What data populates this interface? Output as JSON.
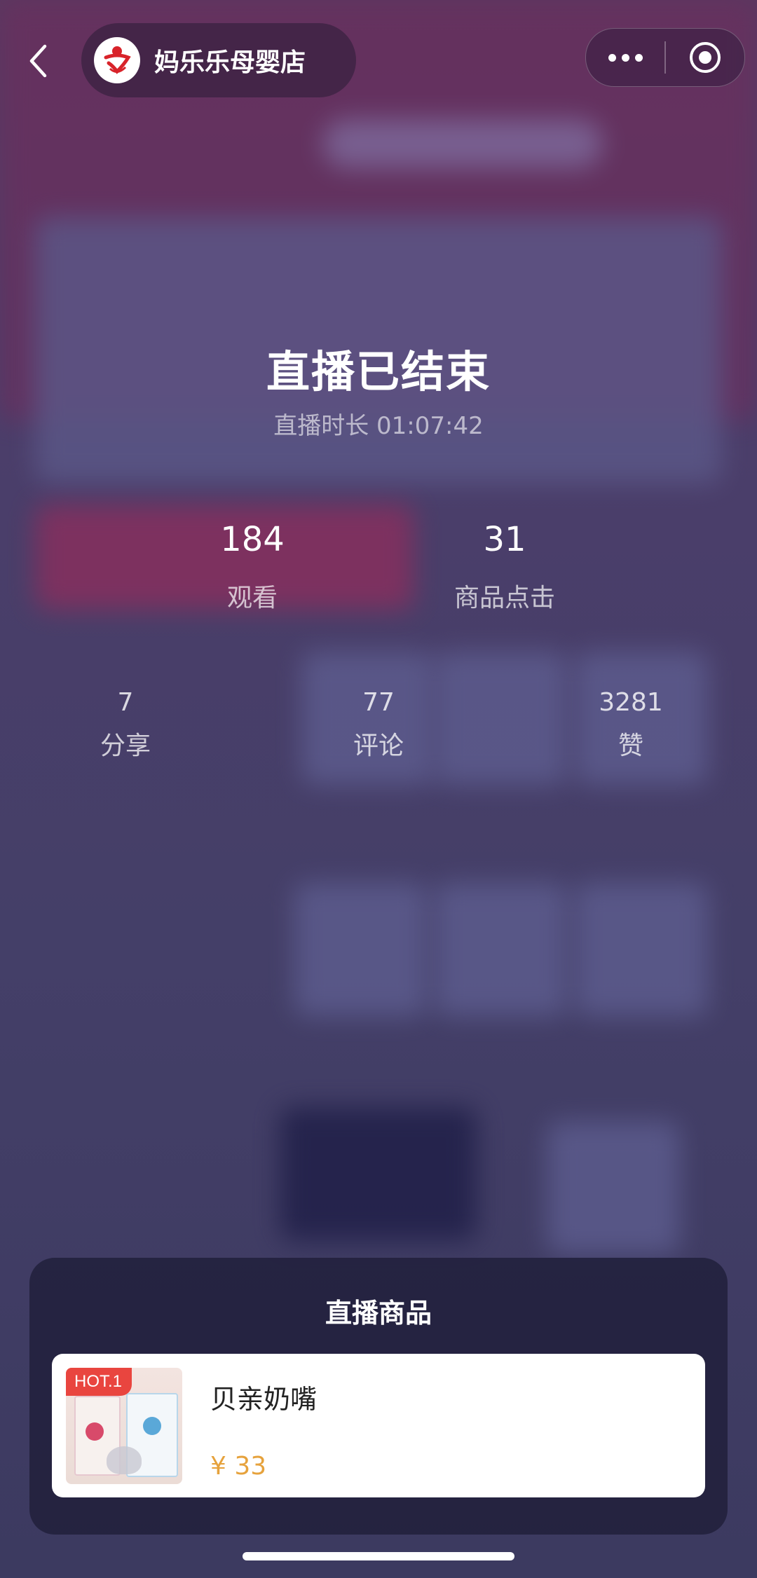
{
  "header": {
    "store_name": "妈乐乐母婴店"
  },
  "live": {
    "status_title": "直播已结束",
    "duration_text": "直播时长 01:07:42"
  },
  "stats_main": [
    {
      "value": "184",
      "label": "观看"
    },
    {
      "value": "31",
      "label": "商品点击"
    }
  ],
  "stats_secondary": [
    {
      "value": "7",
      "label": "分享"
    },
    {
      "value": "77",
      "label": "评论"
    },
    {
      "value": "3281",
      "label": "赞"
    }
  ],
  "products_sheet": {
    "title": "直播商品",
    "items": [
      {
        "tag": "HOT.1",
        "name": "贝亲奶嘴",
        "price": "¥ 33"
      }
    ]
  },
  "colors": {
    "price": "#e6a23c",
    "hot_tag": "#e9453f"
  },
  "icons": [
    "back-icon",
    "store-logo",
    "more-icon",
    "close-target-icon"
  ]
}
